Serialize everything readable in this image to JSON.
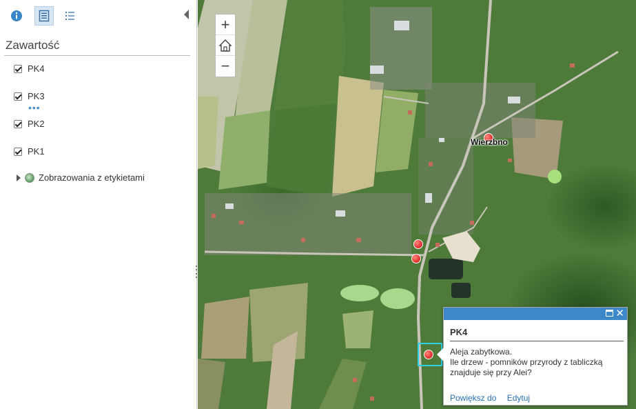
{
  "sidebar": {
    "title": "Zawartość",
    "tools": [
      {
        "icon": "info-icon"
      },
      {
        "icon": "contents-icon",
        "active": true
      },
      {
        "icon": "legend-icon"
      }
    ],
    "layers": [
      {
        "label": "PK4",
        "checked": true
      },
      {
        "label": "PK3",
        "checked": true
      },
      {
        "label": "PK2",
        "checked": true
      },
      {
        "label": "PK1",
        "checked": true
      }
    ],
    "basemap_group": "Zobrazowania z etykietami"
  },
  "map": {
    "zoom_in": "+",
    "zoom_out": "−",
    "place_label": "Wierzbno"
  },
  "popup": {
    "title": "PK4",
    "line1": "Aleja zabytkowa.",
    "line2": "Ile drzew - pomników przyrody z tabliczką znajduje się przy Alei?",
    "close": "✕",
    "zoom_link": "Powiększ do",
    "edit_link": "Edytuj"
  },
  "colors": {
    "popup_header": "#3d88c8",
    "selection": "#2fd0e6",
    "marker": "#e53935",
    "link": "#2a6fb0"
  }
}
